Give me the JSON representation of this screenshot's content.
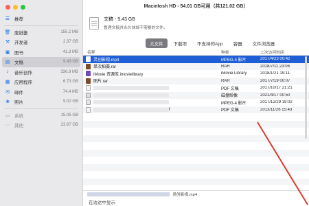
{
  "window": {
    "title": "Macintosh HD - 54.01 GB可用（共121.02 GB）"
  },
  "sidebar": {
    "items": [
      {
        "label": "推荐",
        "size": "",
        "icon": "recommend-icon",
        "selected": false
      },
      {
        "label": "废纸篓",
        "size": "155.2 MB",
        "icon": "trash-icon",
        "selected": false
      },
      {
        "label": "开发者",
        "size": "2.37 GB",
        "icon": "developer-icon",
        "selected": false
      },
      {
        "label": "图书",
        "size": "41.3 MB",
        "icon": "book-icon",
        "selected": false
      },
      {
        "label": "文稿",
        "size": "9.43 GB",
        "icon": "document-icon",
        "selected": true
      },
      {
        "label": "音乐创作",
        "size": "336.9 MB",
        "icon": "music-icon",
        "selected": false
      },
      {
        "label": "应用程序",
        "size": "6.73 GB",
        "icon": "app-icon",
        "selected": false
      },
      {
        "label": "邮件",
        "size": "74.4 MB",
        "icon": "mail-icon",
        "selected": false
      },
      {
        "label": "照片",
        "size": "9.02 GB",
        "icon": "photo-icon",
        "selected": false
      },
      {
        "label": "系统",
        "size": "15.05 GB",
        "icon": "system-icon",
        "selected": false
      },
      {
        "label": "其他",
        "size": "23.67 GB",
        "icon": "other-icon",
        "selected": false
      }
    ]
  },
  "category": {
    "name": "文稿 - 9.43 GB",
    "description": "整理文稿并永久抹掉不需要的文件。"
  },
  "tabs": [
    {
      "label": "大文件",
      "active": true
    },
    {
      "label": "下载项",
      "active": false
    },
    {
      "label": "不支持的App",
      "active": false
    },
    {
      "label": "容器",
      "active": false
    },
    {
      "label": "文件浏览器",
      "active": false
    }
  ],
  "table": {
    "columns": {
      "name": "名称",
      "kind": "种类",
      "date": "上次访问时间"
    },
    "rows": [
      {
        "name": "灵创影视.mp4",
        "kind": "MPEG-4 影片",
        "date": "2017/4/23 00:42",
        "icon": "movie",
        "selected": true,
        "redacted": false
      },
      {
        "name": "单次拍摄.rar",
        "kind": "RAR",
        "date": "2018/7/11 23:06",
        "icon": "rar",
        "selected": false,
        "redacted": false
      },
      {
        "name": "iMovie 资源库.imovielibrary",
        "kind": "iMovie Library",
        "date": "2018/1/21 19:11",
        "icon": "imovie",
        "selected": false,
        "redacted": false
      },
      {
        "name": "图片.rar",
        "kind": "RAR",
        "date": "2017/7/19 00:07",
        "icon": "rar",
        "selected": false,
        "redacted": false
      },
      {
        "name": "",
        "kind": "PDF 文稿",
        "date": "2017/10/17 21:21",
        "icon": "pdf",
        "selected": false,
        "redacted": true
      },
      {
        "name": "",
        "kind": "磁盘映像",
        "date": "2021/4/17 00:50",
        "icon": "disk",
        "selected": false,
        "redacted": true
      },
      {
        "name": "",
        "kind": "MPEG-4 影片",
        "date": "2017/12/29 19:02",
        "icon": "mpeg",
        "selected": false,
        "redacted": true
      },
      {
        "name": "f",
        "kind": "PDF 文稿",
        "date": "2013/11/26 15:43",
        "icon": "pdf",
        "selected": false,
        "redacted": true
      },
      {
        "name": "",
        "kind": "",
        "date": "",
        "icon": "",
        "selected": false,
        "redacted": false
      },
      {
        "name": "",
        "kind": "",
        "date": "",
        "icon": "",
        "selected": false,
        "redacted": false
      },
      {
        "name": "",
        "kind": "",
        "date": "",
        "icon": "",
        "selected": false,
        "redacted": false
      },
      {
        "name": "",
        "kind": "",
        "date": "",
        "icon": "",
        "selected": false,
        "redacted": false
      },
      {
        "name": "",
        "kind": "",
        "date": "",
        "icon": "",
        "selected": false,
        "redacted": false
      },
      {
        "name": "",
        "kind": "",
        "date": "",
        "icon": "",
        "selected": false,
        "redacted": false
      },
      {
        "name": "",
        "kind": "",
        "date": "",
        "icon": "",
        "selected": false,
        "redacted": false
      },
      {
        "name": "",
        "kind": "",
        "date": "",
        "icon": "",
        "selected": false,
        "redacted": false
      },
      {
        "name": "",
        "kind": "",
        "date": "",
        "icon": "",
        "selected": false,
        "redacted": false
      },
      {
        "name": "",
        "kind": "",
        "date": "",
        "icon": "",
        "selected": false,
        "redacted": false
      }
    ]
  },
  "pathbar": {
    "filename": "灵创影视.mp4"
  },
  "bottom": {
    "label": "在访达中显示"
  },
  "colors": {
    "selection": "#1f5fd6",
    "annotation": "#d93a2b"
  }
}
